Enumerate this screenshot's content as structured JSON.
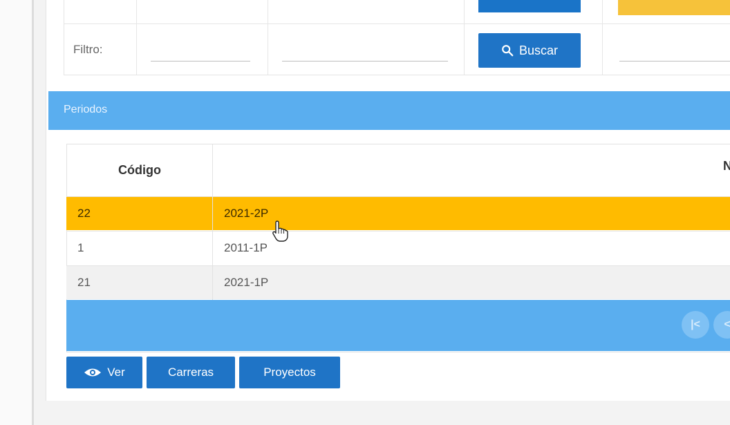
{
  "filter": {
    "label": "Filtro:",
    "input1_value": "",
    "input2_value": "",
    "input3_value": "",
    "search_label": "Buscar",
    "search_icon": "search-icon"
  },
  "periodos": {
    "title": "Periodos",
    "columns": [
      "Código",
      "N"
    ],
    "rows": [
      {
        "code": "22",
        "name": "2021-2P",
        "selected": true
      },
      {
        "code": "1",
        "name": "2011-1P",
        "selected": false
      },
      {
        "code": "21",
        "name": "2021-1P",
        "selected": false
      }
    ]
  },
  "paginator": {
    "first_label": "|<",
    "prev_label": "<"
  },
  "actions": {
    "ver_label": "Ver",
    "carreras_label": "Carreras",
    "proyectos_label": "Proyectos"
  },
  "colors": {
    "primary_button": "#1f74c6",
    "header_bar": "#5aaeef",
    "selected_row": "#ffbb00"
  }
}
